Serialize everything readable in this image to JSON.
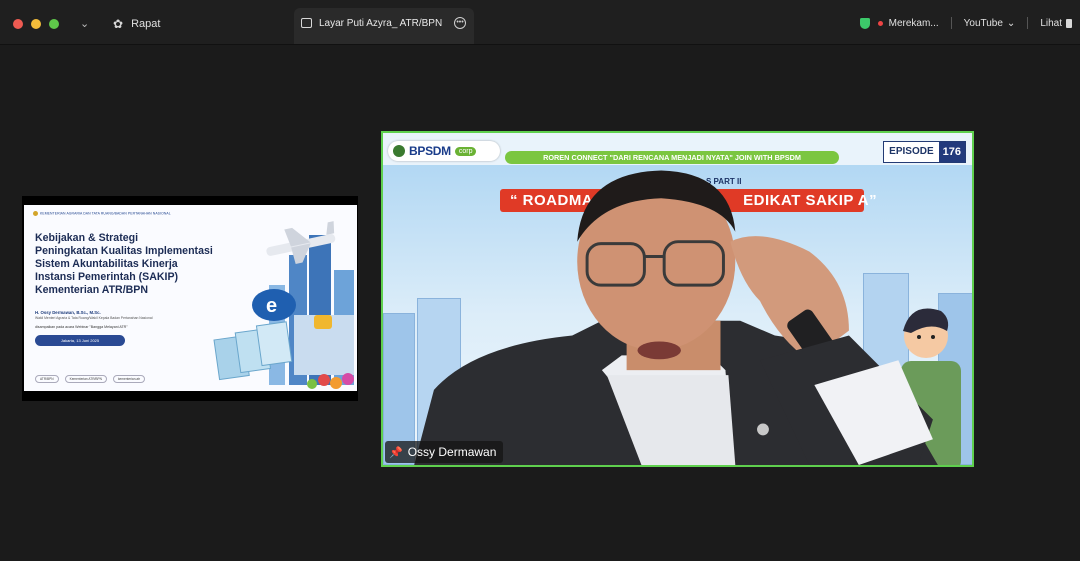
{
  "topbar": {
    "meeting_label": "Rapat",
    "share_tab_label": "Layar Puti Azyra_ ATR/BPN",
    "recording_label": "Merekam...",
    "youtube_label": "YouTube",
    "view_label": "Lihat"
  },
  "slide": {
    "header_text": "KEMENTERIAN AGRARIA DAN TATA RUANG/BADAN PERTANAHAN NASIONAL",
    "title_lines": [
      "Kebijakan & Strategi",
      "Peningkatan Kualitas Implementasi",
      "Sistem Akuntabilitas Kinerja",
      "Instansi Pemerintah (SAKIP)",
      "Kementerian ATR/BPN"
    ],
    "presenter": "H. Ossy Dermawan, B.Sc., M.Sc.",
    "role": "Wakil Menteri Agraria & Tata Ruang/Wakil Kepala Badan Pertanahan Nasional",
    "description": "disampaikan pada acara Webinar \"Bangga Melayani ATR\"",
    "date": "Jakarta, 13 Juni 2025",
    "footer_items": [
      "ATR/BPN",
      "Kementerian ATR/BPN",
      "kementerian.atr"
    ]
  },
  "video": {
    "logo_text": "BPSDM",
    "logo_badge": "corp",
    "episode_label": "EPISODE",
    "episode_number": "176",
    "green_banner": "ROREN CONNECT \"DARI RENCANA MENJADI NYATA\" JOIN WITH BPSDM",
    "subtitle_fragment": "S PART II",
    "red_banner_left": "“ ROADMA",
    "red_banner_right": "EDIKAT SAKIP A”",
    "speaker_name": "Ossy Dermawan"
  }
}
